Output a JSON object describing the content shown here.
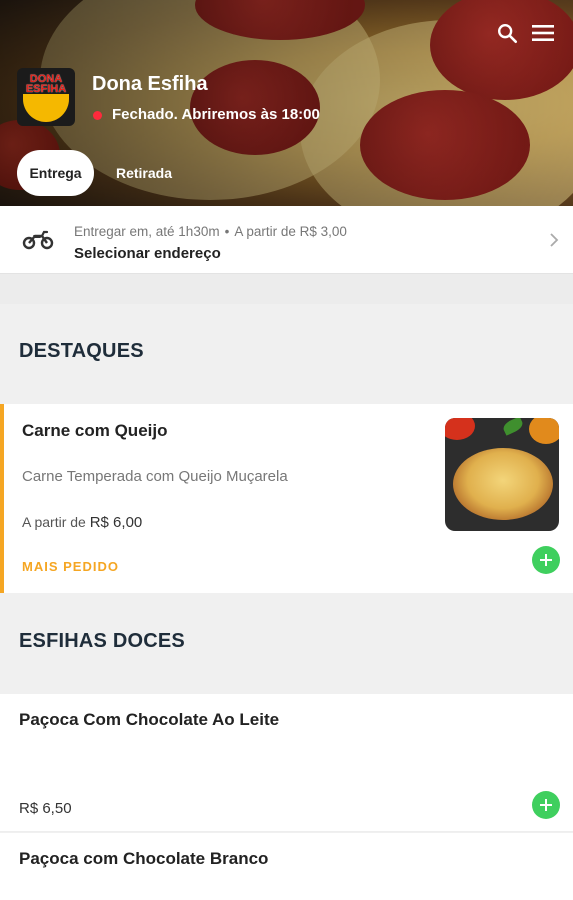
{
  "header": {
    "store_name": "Dona Esfiha",
    "logo_text": "DONA ESFIHA",
    "status": "Fechado. Abriremos às 18:00",
    "status_color": "#ff2a3c",
    "icons": [
      "search-icon",
      "menu-icon"
    ]
  },
  "tabs": [
    {
      "label": "Entrega",
      "selected": true
    },
    {
      "label": "Retirada",
      "selected": false
    }
  ],
  "delivery": {
    "icon": "motorcycle-icon",
    "eta": "Entregar em, até 1h30m",
    "separator": "•",
    "min_fee": "A partir de R$ 3,00",
    "select_label": "Selecionar endereço"
  },
  "sections": [
    {
      "title": "DESTAQUES",
      "items": [
        {
          "name": "Carne com Queijo",
          "description": "Carne Temperada com Queijo Muçarela",
          "price_prefix": "A partir de",
          "price": "R$ 6,00",
          "badge": "MAIS PEDIDO"
        }
      ]
    },
    {
      "title": "ESFIHAS DOCES",
      "items": [
        {
          "name": "Paçoca Com Chocolate Ao Leite",
          "price": "R$ 6,50"
        },
        {
          "name": "Paçoca com Chocolate Branco"
        }
      ]
    }
  ],
  "colors": {
    "accent": "#f5a623",
    "add_button": "#3fcf5e",
    "section_title": "#1f2d3a"
  }
}
